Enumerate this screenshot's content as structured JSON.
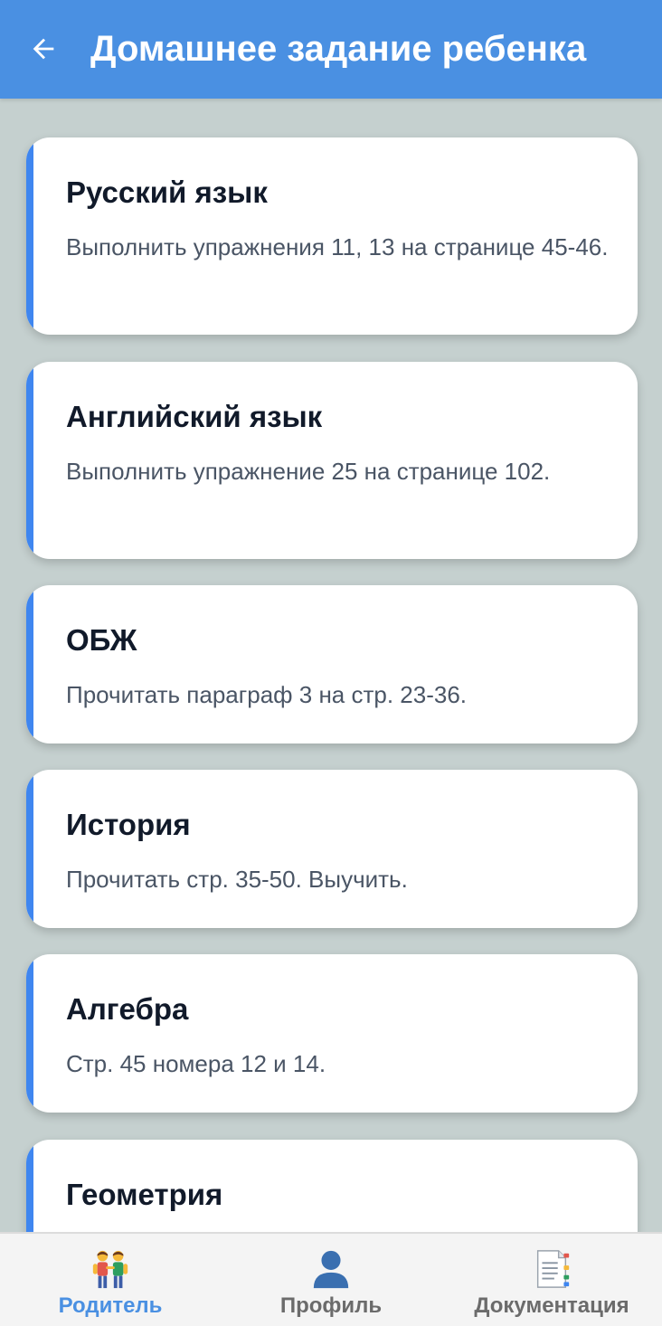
{
  "header": {
    "title": "Домашнее задание ребенка",
    "back_icon": "arrow-left-icon"
  },
  "colors": {
    "primary": "#4a90e2",
    "accent": "#3f86f0",
    "background": "#c5d0cf",
    "nav_active": "#4a90e2",
    "nav_inactive": "#6b6b6b"
  },
  "homework": [
    {
      "subject": "Русский язык",
      "task": "Выполнить упражнения 11, 13 на странице 45-46."
    },
    {
      "subject": "Английский язык",
      "task": "Выполнить упражнение 25 на странице 102."
    },
    {
      "subject": "ОБЖ",
      "task": "Прочитать параграф 3 на стр. 23-36."
    },
    {
      "subject": "История",
      "task": "Прочитать стр. 35-50. Выучить."
    },
    {
      "subject": "Алгебра",
      "task": "Стр. 45 номера 12 и 14."
    },
    {
      "subject": "Геометрия",
      "task": ""
    }
  ],
  "bottom_nav": {
    "items": [
      {
        "label": "Родитель",
        "icon": "parents-icon",
        "active": true
      },
      {
        "label": "Профиль",
        "icon": "profile-icon",
        "active": false
      },
      {
        "label": "Документация",
        "icon": "document-icon",
        "active": false
      }
    ]
  }
}
